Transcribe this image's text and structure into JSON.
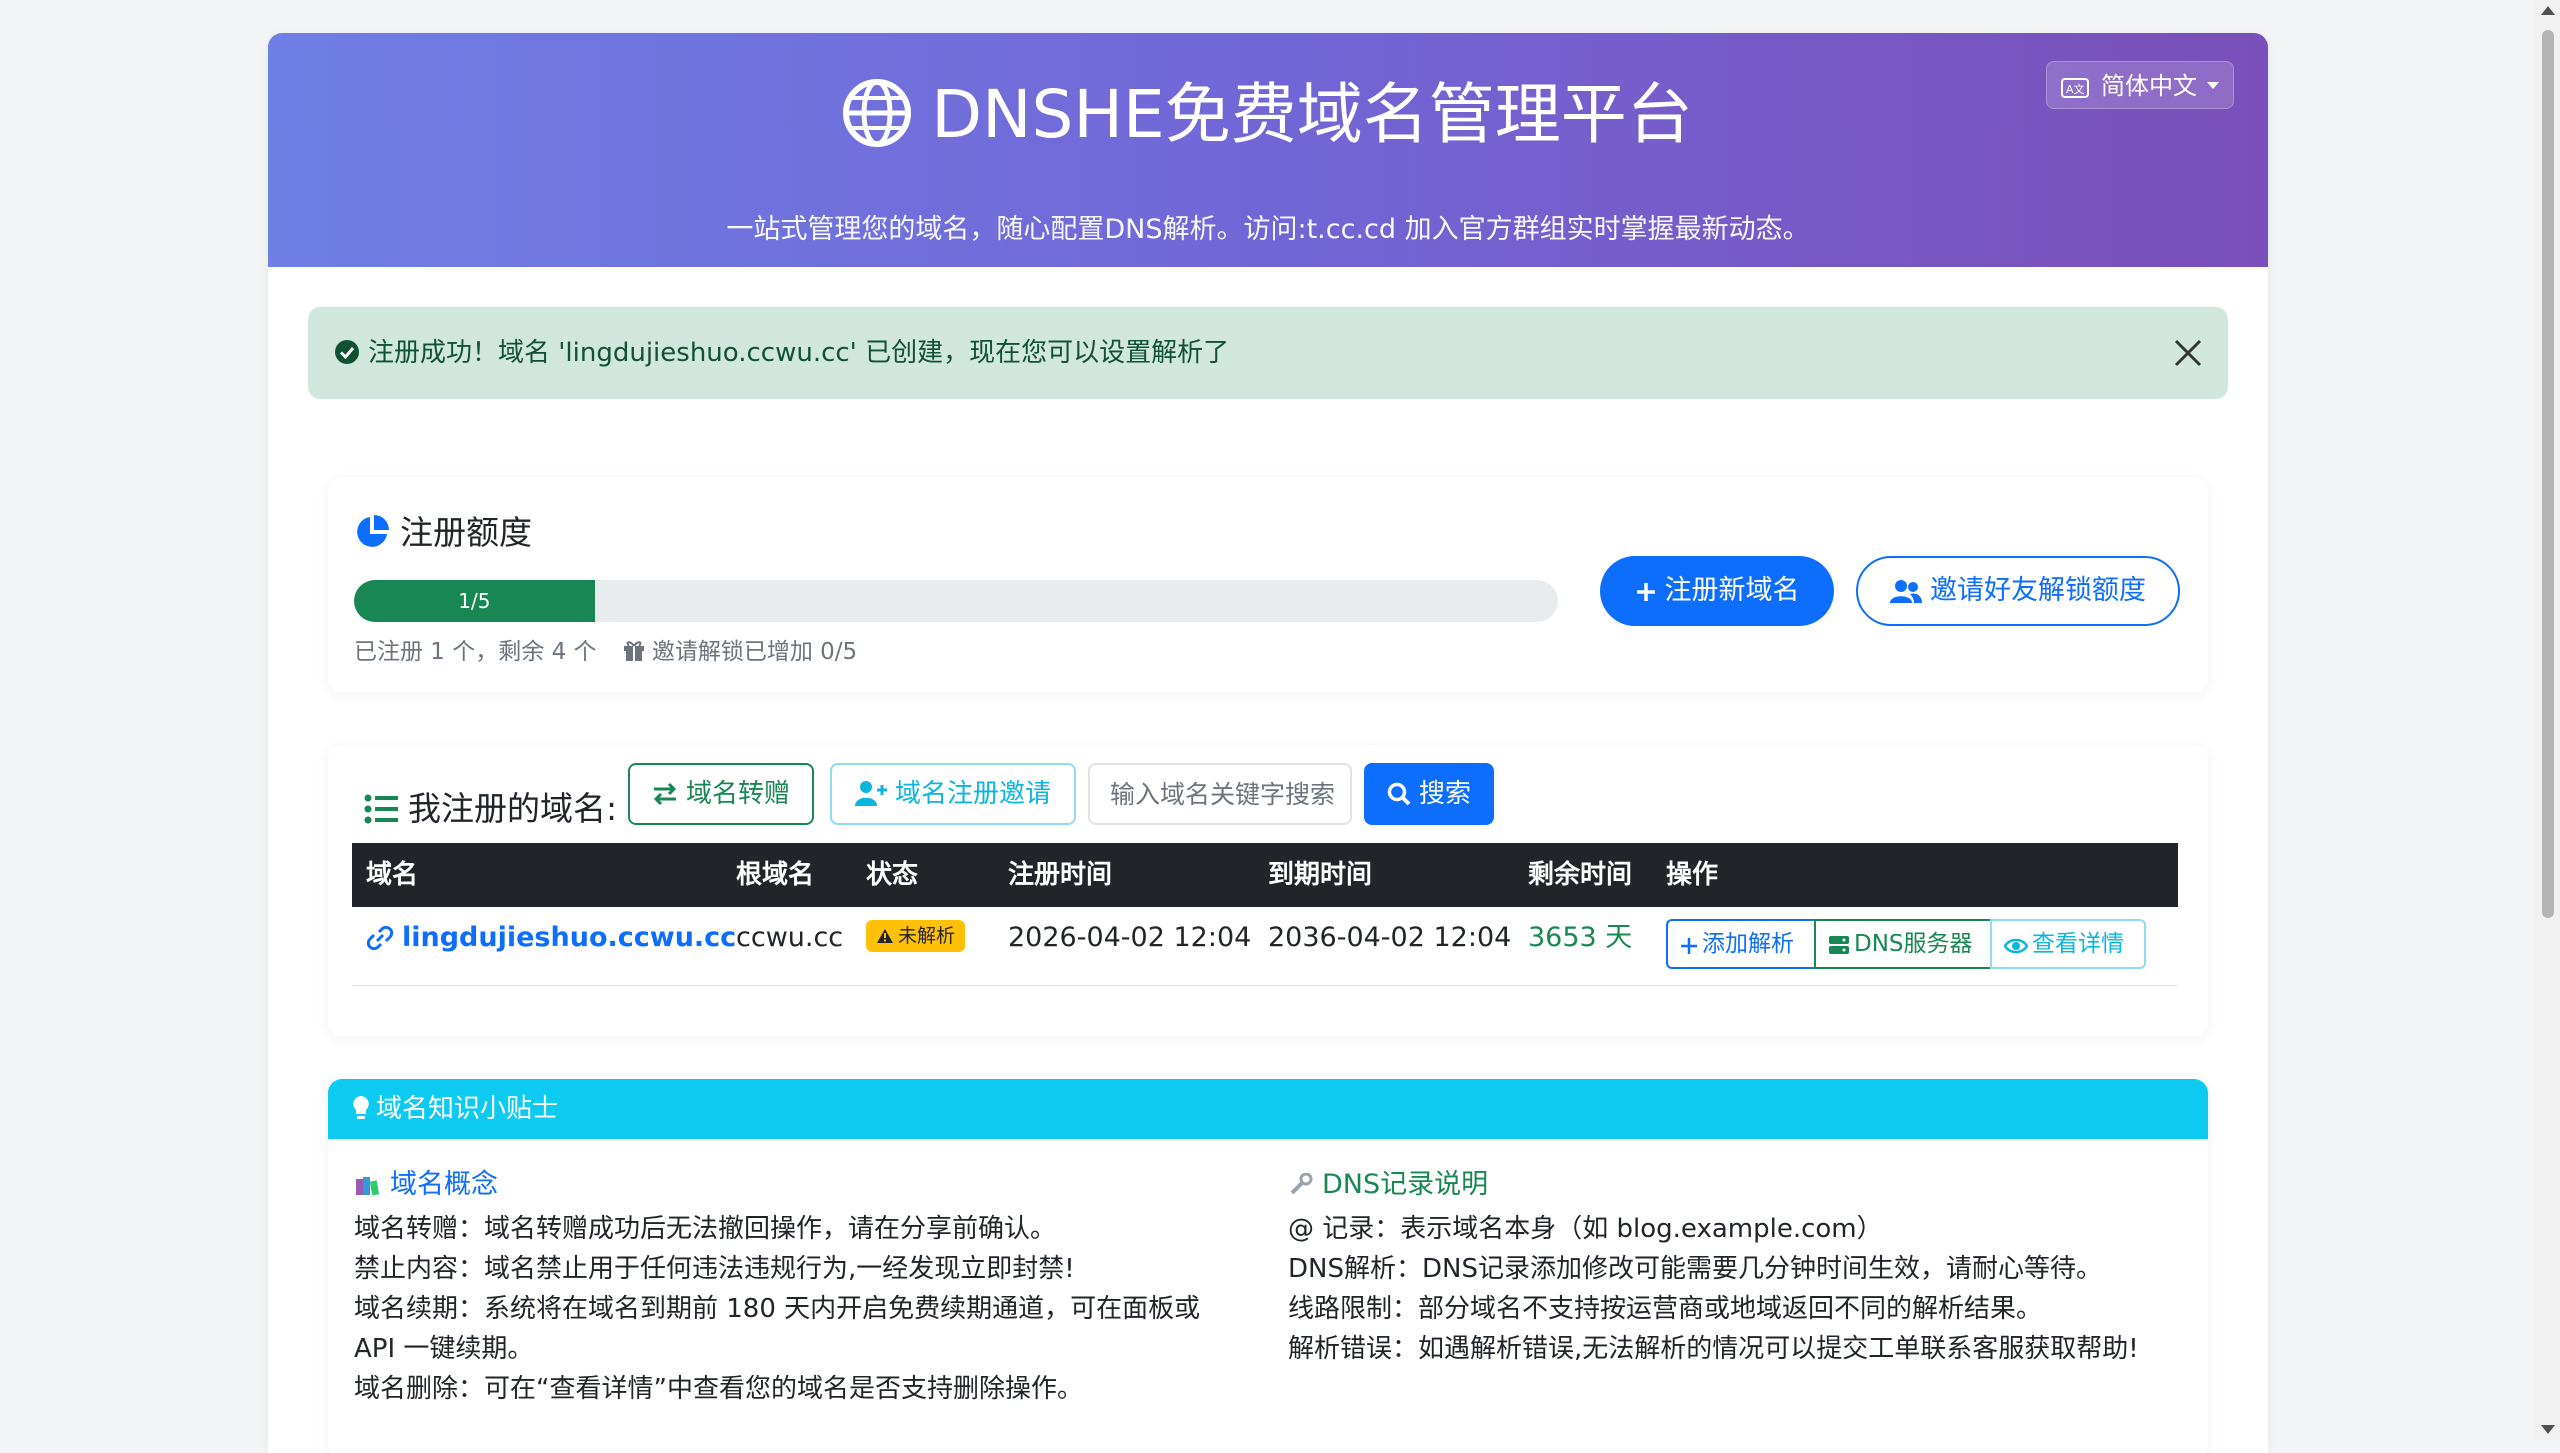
{
  "header": {
    "title": "DNSHE免费域名管理平台",
    "subtitle": "一站式管理您的域名，随心配置DNS解析。访问:t.cc.cd 加入官方群组实时掌握最新动态。",
    "language": "简体中文"
  },
  "alert": {
    "message": "注册成功！域名 'lingdujieshuo.ccwu.cc' 已创建，现在您可以设置解析了"
  },
  "quota": {
    "title": "注册额度",
    "progress_label": "1/5",
    "progress_fraction": 0.2,
    "note": "已注册 1 个，剩余 4 个",
    "invite_note": "邀请解锁已增加 0/5",
    "register_button": "注册新域名",
    "invite_button": "邀请好友解锁额度"
  },
  "domains": {
    "title": "我注册的域名:",
    "transfer_button": "域名转赠",
    "invite_button": "域名注册邀请",
    "search_placeholder": "输入域名关键字搜索",
    "search_button": "搜索",
    "columns": [
      "域名",
      "根域名",
      "状态",
      "注册时间",
      "到期时间",
      "剩余时间",
      "操作"
    ],
    "rows": [
      {
        "domain": "lingdujieshuo.ccwu.cc",
        "root": "ccwu.cc",
        "status": "未解析",
        "registered": "2026-04-02 12:04",
        "expires": "2036-04-02 12:04",
        "remaining": "3653 天",
        "actions": [
          "添加解析",
          "DNS服务器",
          "查看详情"
        ]
      }
    ]
  },
  "tips": {
    "title": "域名知识小贴士",
    "left": {
      "heading": "域名概念",
      "lines": [
        "域名转赠：域名转赠成功后无法撤回操作，请在分享前确认。",
        "禁止内容：域名禁止用于任何违法违规行为,一经发现立即封禁!",
        "域名续期：系统将在域名到期前 180 天内开启免费续期通道，可在面板或",
        "API 一键续期。",
        "域名删除：可在“查看详情”中查看您的域名是否支持删除操作。"
      ]
    },
    "right": {
      "heading": "DNS记录说明",
      "lines": [
        "@ 记录：表示域名本身（如 blog.example.com）",
        "DNS解析：DNS记录添加修改可能需要几分钟时间生效，请耐心等待。",
        "线路限制：部分域名不支持按运营商或地域返回不同的解析结果。",
        "解析错误：如遇解析错误,无法解析的情况可以提交工单联系客服获取帮助!"
      ]
    }
  },
  "colors": {
    "primary": "#0d6efd",
    "success": "#198754",
    "info": "#0dcaf0",
    "warning": "#ffc107",
    "hero_start": "#6f7fe4",
    "hero_end": "#7b4fb9"
  },
  "icons": [
    "globe-icon",
    "language-icon",
    "check-circle-icon",
    "close-icon",
    "pie-chart-icon",
    "plus-icon",
    "users-icon",
    "gift-icon",
    "list-icon",
    "transfer-icon",
    "user-plus-icon",
    "search-icon",
    "link-icon",
    "warning-icon",
    "server-icon",
    "eye-icon",
    "lightbulb-icon",
    "books-icon",
    "wrench-icon"
  ]
}
